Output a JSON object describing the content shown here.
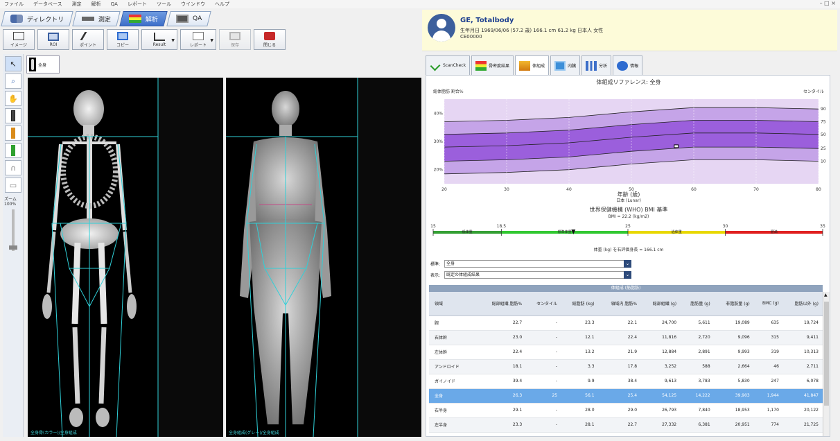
{
  "menu": [
    "ファイル",
    "データベース",
    "測定",
    "解析",
    "QA",
    "レポート",
    "ツール",
    "ウインドウ",
    "ヘルプ"
  ],
  "window_controls": "– □ ×",
  "mode_tabs": [
    {
      "label": "ディレクトリ",
      "icon": "people-icon"
    },
    {
      "label": "測定",
      "icon": "scanner-icon"
    },
    {
      "label": "解析",
      "icon": "analysis-icon"
    },
    {
      "label": "QA",
      "icon": "qa-icon"
    }
  ],
  "toolbar": [
    {
      "label": "イメージ",
      "icon": "image-icon"
    },
    {
      "label": "ROI",
      "icon": "roi-icon"
    },
    {
      "label": "ポイント",
      "icon": "point-icon"
    },
    {
      "label": "コピー",
      "icon": "copy-icon"
    },
    {
      "label": "Result",
      "icon": "result-icon",
      "drop": true
    },
    {
      "label": "レポート",
      "icon": "report-icon",
      "drop": true
    },
    {
      "label": "保存",
      "icon": "save-icon",
      "disabled": true
    },
    {
      "label": "閉じる",
      "icon": "close-icon"
    }
  ],
  "vtools": [
    "↖",
    "🔍",
    "✋",
    "▮",
    "▮",
    "▮",
    "∩",
    "▭"
  ],
  "zoom": {
    "label": "ズーム",
    "value": "100%"
  },
  "image_tab": {
    "label": "全身"
  },
  "scan_captions": [
    "全身骨(カラー)/全身組成",
    "全身組成(グレー)/全身組成"
  ],
  "patient": {
    "name": "GE, Totalbody",
    "info": "生年月日 1969/06/06 (57.2 歳)   166.1 cm  61.2 kg  日本人 女性",
    "id": "CE00000"
  },
  "right_tabs": [
    {
      "label": "ScanCheck",
      "icon": "check-icon"
    },
    {
      "label": "骨密度結果",
      "icon": "bmd-icon"
    },
    {
      "label": "体組成",
      "icon": "composition-icon",
      "active": true
    },
    {
      "label": "内臓",
      "icon": "visceral-icon"
    },
    {
      "label": "分析",
      "icon": "analysis-chart-icon"
    },
    {
      "label": "情報",
      "icon": "info-icon"
    }
  ],
  "composition": {
    "ref_title": "体組成リファレンス: 全身",
    "ylabel": "総体脂肪 割合%",
    "percentile_label": "センタイル",
    "xlabel": "年齢 (歳)",
    "ref_source": "日本 (Lunar)",
    "bmi_title": "世界保健機構 (WHO) BMI 基準",
    "bmi_value": "BMI = 22.2 (kg/m2)",
    "bmi_note": "体重 (kg) を右評価身長 = 166.1 cm",
    "field1_label": "標準:",
    "field1_value": "全身",
    "field2_label": "表示:",
    "field2_value": "既定の体組成結果",
    "table_caption": "体組成 (筋脂肪)"
  },
  "chart_data": [
    {
      "type": "area",
      "title": "体組成リファレンス: 全身",
      "xlabel": "年齢 (歳)",
      "ylabel": "総体脂肪 割合%",
      "xlim": [
        20,
        80
      ],
      "ylim": [
        15,
        45
      ],
      "x_ticks": [
        20,
        30,
        40,
        50,
        60,
        70,
        80
      ],
      "y_ticks": [
        "40%",
        "30%",
        "20%"
      ],
      "percentile_ticks": [
        90,
        75,
        50,
        25,
        10
      ],
      "percentile_curves": {
        "x": [
          20,
          30,
          40,
          50,
          60,
          70,
          80
        ],
        "p10": [
          18.5,
          19.0,
          20.0,
          22.0,
          23.5,
          23.5,
          23.0
        ],
        "p25": [
          23.0,
          23.5,
          24.5,
          26.5,
          28.0,
          28.0,
          27.5
        ],
        "p50": [
          28.0,
          28.5,
          29.5,
          31.5,
          33.0,
          33.0,
          32.5
        ],
        "p75": [
          32.5,
          33.0,
          34.0,
          36.0,
          37.5,
          37.5,
          37.0
        ],
        "p90": [
          37.0,
          37.5,
          38.5,
          40.5,
          42.0,
          42.0,
          41.5
        ]
      },
      "patient_point": {
        "x": 57.2,
        "y": 28.3
      }
    },
    {
      "type": "bar",
      "title": "世界保健機構 (WHO) BMI 基準",
      "scale_ticks": [
        15,
        18.5,
        25,
        30,
        35
      ],
      "scale_labels": [
        "低体重",
        "標準体重",
        "過体重",
        "肥満"
      ],
      "segment_colors": [
        "#35a035",
        "#32c832",
        "#e8d800",
        "#e02020"
      ],
      "patient_bmi": 22.2
    }
  ],
  "table": {
    "headers": [
      "領域",
      "総部組織 脂肪%",
      "センタイル",
      "総脂肪 (kg)",
      "領域内 脂肪%",
      "総部組織 (g)",
      "脂肪量 (g)",
      "非脂肪量 (g)",
      "BMC (g)",
      "脂肪以外 (g)"
    ],
    "rows": [
      [
        "腕",
        "22.7",
        "-",
        "23.3",
        "22.1",
        "24,700",
        "5,611",
        "19,089",
        "635",
        "19,724"
      ],
      [
        "右体幹",
        "23.0",
        "-",
        "12.1",
        "22.4",
        "11,816",
        "2,720",
        "9,096",
        "315",
        "9,411"
      ],
      [
        "左体幹",
        "22.4",
        "-",
        "13.2",
        "21.9",
        "12,884",
        "2,891",
        "9,993",
        "319",
        "10,313"
      ],
      [
        "アンドロイド",
        "18.1",
        "-",
        "3.3",
        "17.8",
        "3,252",
        "588",
        "2,664",
        "46",
        "2,711"
      ],
      [
        "ガイノイド",
        "39.4",
        "-",
        "9.9",
        "38.4",
        "9,613",
        "3,783",
        "5,830",
        "247",
        "6,078"
      ],
      [
        "全身",
        "26.3",
        "25",
        "56.1",
        "25.4",
        "54,125",
        "14,222",
        "39,903",
        "1,944",
        "41,847"
      ],
      [
        "右半身",
        "29.1",
        "-",
        "28.0",
        "29.0",
        "26,793",
        "7,840",
        "18,953",
        "1,170",
        "20,122"
      ],
      [
        "左半身",
        "23.3",
        "-",
        "28.1",
        "22.7",
        "27,332",
        "6,381",
        "20,951",
        "774",
        "21,725"
      ]
    ],
    "highlight_row": 5
  }
}
